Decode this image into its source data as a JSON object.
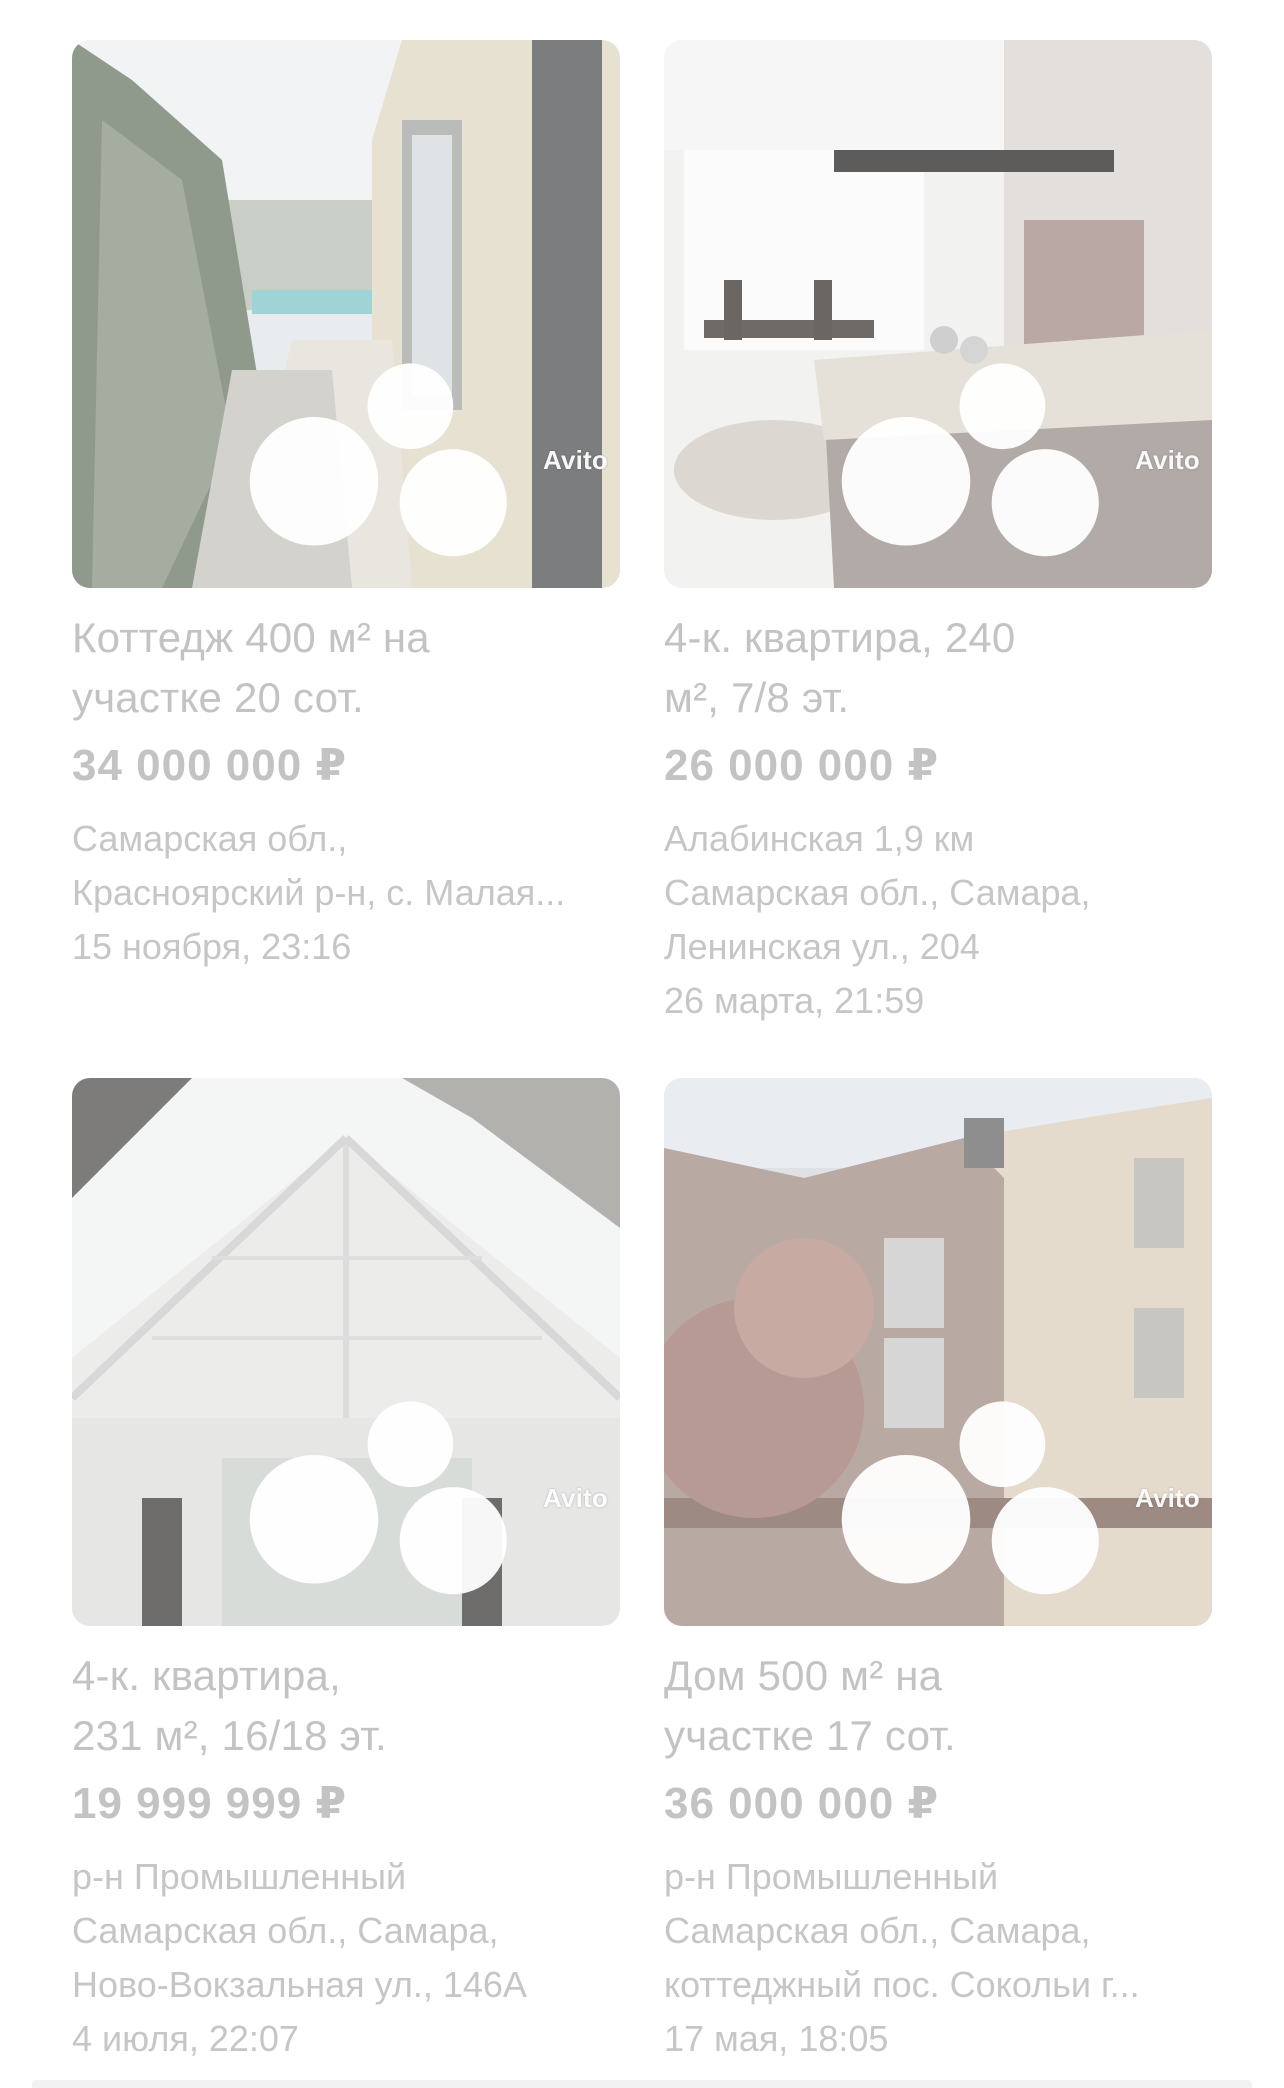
{
  "watermark": "Avito",
  "colors": {
    "text_faded": "#c3c3c3",
    "background": "#ffffff"
  },
  "listings": [
    {
      "title_line1": "Коттедж 400 м² на",
      "title_line2": "участке 20 сот.",
      "price": "34 000 000 ₽",
      "location_line1": "Самарская обл.,",
      "location_line2": "Красноярский р-н, с. Малая...",
      "location_line3": "",
      "date": "15 ноября, 23:16",
      "photo_icon": "cottage-balcony-photo"
    },
    {
      "title_line1": "4-к. квартира, 240",
      "title_line2": "м², 7/8 эт.",
      "price": "26 000 000 ₽",
      "location_line1": "Алабинская 1,9 км",
      "location_line2": "Самарская обл., Самара,",
      "location_line3": "Ленинская ул., 204",
      "date": "26 марта, 21:59",
      "photo_icon": "kitchen-interior-photo"
    },
    {
      "title_line1": "4-к. квартира,",
      "title_line2": "231 м², 16/18 эт.",
      "price": "19 999 999 ₽",
      "location_line1": "р-н Промышленный",
      "location_line2": "Самарская обл., Самара,",
      "location_line3": "Ново-Вокзальная ул., 146А",
      "date": "4 июля, 22:07",
      "photo_icon": "glass-roof-photo"
    },
    {
      "title_line1": "Дом 500 м² на",
      "title_line2": "участке 17 сот.",
      "price": "36 000 000 ₽",
      "location_line1": "р-н Промышленный",
      "location_line2": "Самарская обл., Самара,",
      "location_line3": "коттеджный пос. Сокольи г...",
      "date": "17 мая, 18:05",
      "photo_icon": "brick-house-photo"
    }
  ]
}
